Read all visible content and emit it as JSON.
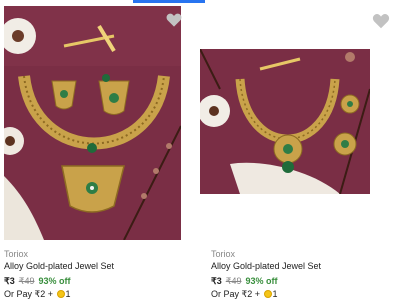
{
  "products": [
    {
      "brand": "Toriox",
      "title": "Alloy Gold-plated Jewel Set",
      "price": "₹3",
      "mrp": "₹49",
      "discount": "93% off",
      "pay_prefix": "Or Pay ₹2 +",
      "pay_coins": "1",
      "wishlist_icon": "heart-icon",
      "wishlist_color": "#c2c2c2"
    },
    {
      "brand": "Toriox",
      "title": "Alloy Gold-plated Jewel Set",
      "price": "₹3",
      "mrp": "₹49",
      "discount": "93% off",
      "pay_prefix": "Or Pay ₹2 +",
      "pay_coins": "1",
      "wishlist_icon": "heart-icon",
      "wishlist_color": "#c2c2c2"
    }
  ],
  "colors": {
    "accent": "#2874f0",
    "discount": "#388e3c",
    "photo_background": "#7a2e45",
    "gold": "#c9a24a"
  }
}
